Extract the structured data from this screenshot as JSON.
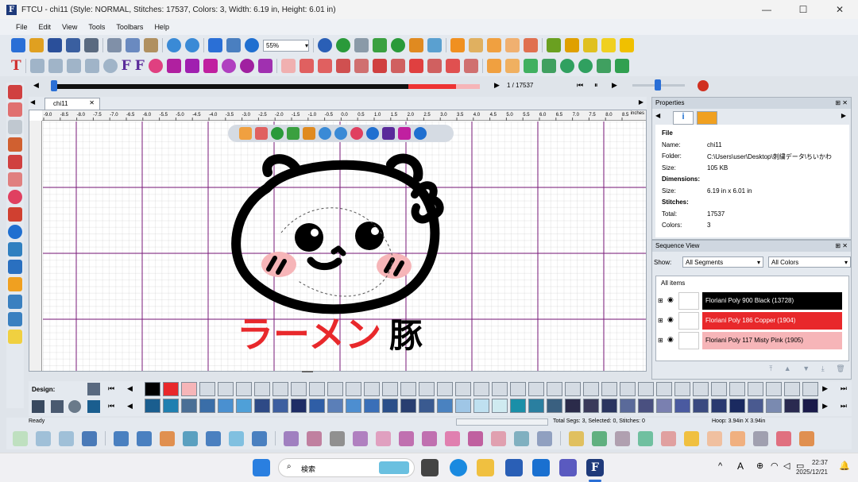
{
  "window": {
    "title": "FTCU - chi11 (Style: NORMAL, Stitches: 17537, Colors: 3, Width: 6.19 in, Height: 6.01 in)",
    "logo_letter": "F",
    "minimize": "—",
    "maximize": "☐",
    "close": "✕"
  },
  "menu": [
    "File",
    "Edit",
    "View",
    "Tools",
    "Toolbars",
    "Help"
  ],
  "toolbar": {
    "zoom_value": "55%"
  },
  "playback": {
    "stitch_counter": "1 / 17537"
  },
  "document": {
    "tab_label": "chi11",
    "ruler_unit": "inches",
    "ruler_labels": [
      "-9.0",
      "-8.5",
      "-8.0",
      "-7.5",
      "-7.0",
      "-6.5",
      "-6.0",
      "-5.5",
      "-5.0",
      "-4.5",
      "-4.0",
      "-3.5",
      "-3.0",
      "-2.5",
      "-2.0",
      "-1.5",
      "-1.0",
      "-0.5",
      "0.0",
      "0.5",
      "1.0",
      "1.5",
      "2.0",
      "2.5",
      "3.0",
      "3.5",
      "4.0",
      "4.5",
      "5.0",
      "5.5",
      "6.0",
      "6.5",
      "7.0",
      "7.5",
      "8.0",
      "8.5"
    ],
    "artwork_text": "ラーメン豚"
  },
  "properties": {
    "title": "Properties",
    "file_heading": "File",
    "name_label": "Name:",
    "name_value": "chi11",
    "folder_label": "Folder:",
    "folder_value": "C:\\Users\\user\\Desktop\\刺繍データ\\ちいかわ",
    "size_label": "Size:",
    "size_value": "105 KB",
    "dimensions_heading": "Dimensions:",
    "dim_size_label": "Size:",
    "dim_size_value": "6.19 in x 6.01 in",
    "stitches_heading": "Stitches:",
    "total_label": "Total:",
    "total_value": "17537",
    "colors_label": "Colors:",
    "colors_value": "3"
  },
  "sequence": {
    "title": "Sequence View",
    "show_label": "Show:",
    "segments_select": "All Segments",
    "colors_select": "All Colors",
    "all_items": "All items",
    "items": [
      {
        "label": "Floriani Poly 900 Black (13728)",
        "color": "#000000",
        "text_color": "#ffffff"
      },
      {
        "label": "Floriani Poly 186 Copper (1904)",
        "color": "#e8282b",
        "text_color": "#ffffff"
      },
      {
        "label": "Floriani Poly 117 Misty Pink (1905)",
        "color": "#f6b5b8",
        "text_color": "#000000"
      }
    ]
  },
  "design": {
    "label": "Design:",
    "row1_colors": [
      "#000000",
      "#e8282b",
      "#f6b5b8",
      "#d4dbe3",
      "#d4dbe3",
      "#d4dbe3",
      "#d4dbe3",
      "#d4dbe3",
      "#d4dbe3",
      "#d4dbe3",
      "#d4dbe3",
      "#d4dbe3",
      "#d4dbe3",
      "#d4dbe3",
      "#d4dbe3",
      "#d4dbe3",
      "#d4dbe3",
      "#d4dbe3",
      "#d4dbe3",
      "#d4dbe3",
      "#d4dbe3",
      "#d4dbe3",
      "#d4dbe3",
      "#d4dbe3",
      "#d4dbe3",
      "#d4dbe3",
      "#d4dbe3",
      "#d4dbe3",
      "#d4dbe3",
      "#d4dbe3",
      "#d4dbe3",
      "#d4dbe3",
      "#d4dbe3",
      "#d4dbe3",
      "#d4dbe3",
      "#d4dbe3",
      "#d4dbe3"
    ],
    "row2_colors": [
      "#1a5e8f",
      "#1f7fb0",
      "#4a6f96",
      "#3a6ea8",
      "#4a90d0",
      "#4fa0d8",
      "#2e4a86",
      "#3d5fa0",
      "#1e2d66",
      "#2f5ea6",
      "#5b7fb8",
      "#4d8ed0",
      "#3a6fb8",
      "#2a4f8a",
      "#283e70",
      "#3a5a90",
      "#4a82c0",
      "#9fc6e6",
      "#bfe0f0",
      "#cfeaf0",
      "#1a8fa8",
      "#2a7fa0",
      "#3a6080",
      "#2b2b4a",
      "#3a3a5a",
      "#2a3560",
      "#5a6a9a",
      "#4a5080",
      "#7a80b0",
      "#4a5aa0",
      "#3a4a80",
      "#2a3a70",
      "#1a2a60",
      "#4a5a90",
      "#7a8ab0",
      "#2a2a50",
      "#1a1a4a"
    ]
  },
  "status": {
    "ready": "Ready",
    "selection": "Total Segs: 3, Selected: 0, Stitches: 0",
    "hoop": "Hoop: 3.94in X 3.94in"
  },
  "taskbar": {
    "search_placeholder": "検索",
    "ime_letter": "A",
    "time": "22:37",
    "date": "2025/12/21"
  }
}
